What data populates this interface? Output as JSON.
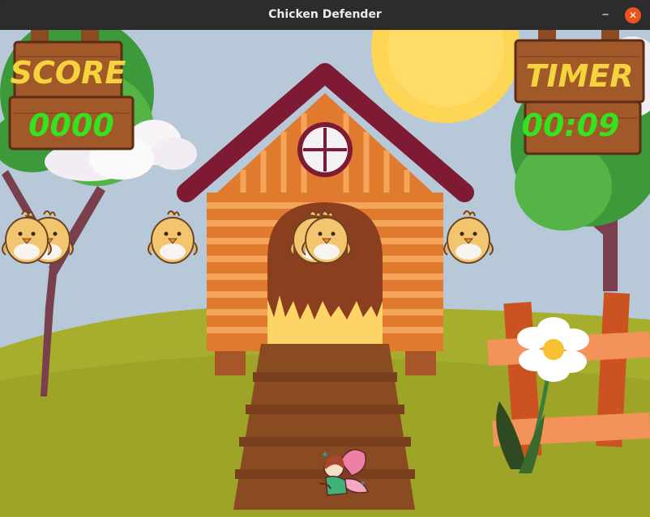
{
  "window": {
    "title": "Chicken Defender",
    "minimize_glyph": "–",
    "close_glyph": "✕"
  },
  "hud": {
    "score_label": "SCORE",
    "score_value": "0000",
    "timer_label": "TIMER",
    "timer_value": "00:09"
  },
  "colors": {
    "sky": "#b7c9d9",
    "grass": "#a7ad2c",
    "sun": "#fdd655",
    "roof": "#7e1a33",
    "wood": "#e07a2e",
    "sign_text_yellow": "#f5d33d",
    "sign_text_green": "#35e21f",
    "close_button": "#e95420"
  },
  "sprites": {
    "chicks": [
      "chick-icon",
      "chick-icon",
      "chick-icon",
      "chick-icon",
      "chick-icon",
      "chick-icon"
    ],
    "player": "fairy-icon",
    "decor": [
      "sun-icon",
      "cloud-icon",
      "tree-icon",
      "coop-icon",
      "fence-icon",
      "daisy-icon"
    ]
  }
}
